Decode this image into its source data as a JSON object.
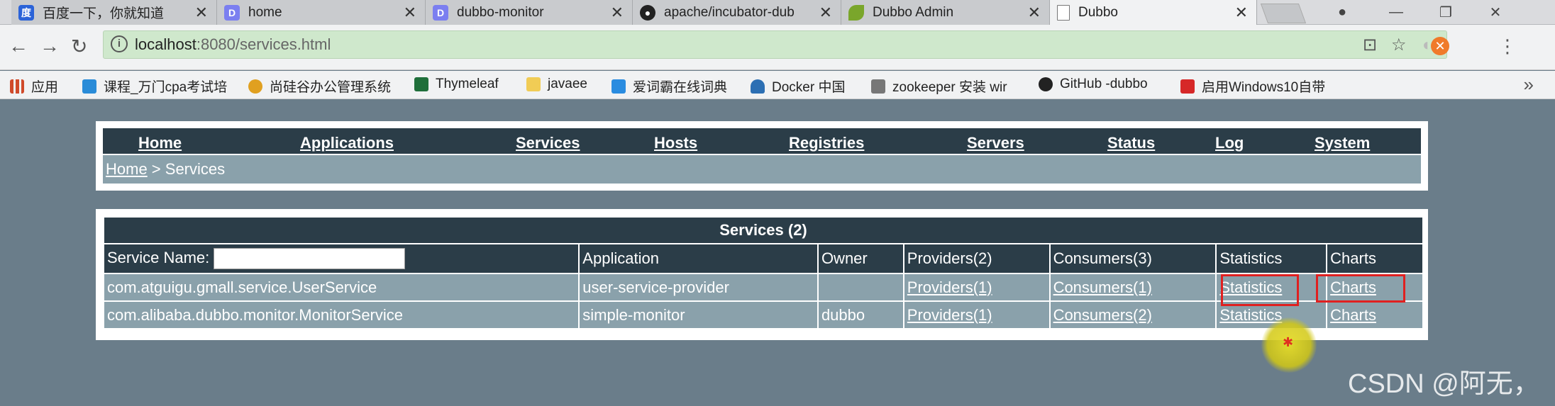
{
  "browser": {
    "tabs": [
      {
        "title": "百度一下，你就知道",
        "icon": "baidu-icon",
        "color": "#2b63d8"
      },
      {
        "title": "home",
        "icon": "page-icon",
        "color": "#7b7ff0"
      },
      {
        "title": "dubbo-monitor",
        "icon": "page-icon",
        "color": "#7b7ff0"
      },
      {
        "title": "apache/incubator-dub",
        "icon": "github-icon",
        "color": "#222222"
      },
      {
        "title": "Dubbo Admin",
        "icon": "leaf-icon",
        "color": "#7aa62b"
      },
      {
        "title": "Dubbo",
        "icon": "document-icon",
        "color": "#888888"
      }
    ],
    "url_host": "localhost",
    "url_rest": ":8080/services.html",
    "bookmarks": [
      {
        "label": "应用",
        "icon": "apps-icon",
        "color": "#d04a2a"
      },
      {
        "label": "课程_万门cpa考试培",
        "icon": "bird-icon",
        "color": "#2a8cd8"
      },
      {
        "label": "尚硅谷办公管理系统",
        "icon": "u-icon",
        "color": "#e0a020"
      },
      {
        "label": "Thymeleaf",
        "icon": "check-icon",
        "color": "#1f6f3a"
      },
      {
        "label": "javaee",
        "icon": "folder-icon",
        "color": "#f1cc55"
      },
      {
        "label": "爱词霸在线词典",
        "icon": "dictionary-icon",
        "color": "#2a8ce0"
      },
      {
        "label": "Docker 中国",
        "icon": "docker-icon",
        "color": "#2c6fb3"
      },
      {
        "label": "zookeeper 安装 wir",
        "icon": "feather-icon",
        "color": "#555555"
      },
      {
        "label": "GitHub -dubbo",
        "icon": "github-icon",
        "color": "#222222"
      },
      {
        "label": "启用Windows10自带",
        "icon": "c-icon",
        "color": "#d62828"
      }
    ]
  },
  "nav": {
    "items": [
      "Home",
      "Applications",
      "Services",
      "Hosts",
      "Registries",
      "Servers",
      "Status",
      "Log",
      "System"
    ],
    "breadcrumb_home": "Home",
    "breadcrumb_sep": " > ",
    "breadcrumb_current": "Services"
  },
  "services": {
    "title": "Services (2)",
    "search_label": "Service Name:",
    "search_value": "",
    "columns": {
      "application": "Application",
      "owner": "Owner",
      "providers": "Providers(2)",
      "consumers": "Consumers(3)",
      "statistics": "Statistics",
      "charts": "Charts"
    },
    "rows": [
      {
        "name": "com.atguigu.gmall.service.UserService",
        "application": "user-service-provider",
        "owner": "",
        "providers": "Providers(1)",
        "consumers": "Consumers(1)",
        "statistics": "Statistics",
        "charts": "Charts"
      },
      {
        "name": "com.alibaba.dubbo.monitor.MonitorService",
        "application": "simple-monitor",
        "owner": "dubbo",
        "providers": "Providers(1)",
        "consumers": "Consumers(2)",
        "statistics": "Statistics",
        "charts": "Charts"
      }
    ]
  },
  "watermark": "CSDN @阿无，"
}
